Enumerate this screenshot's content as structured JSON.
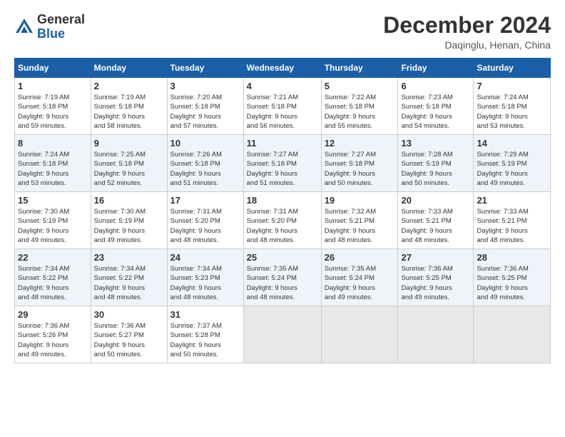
{
  "header": {
    "logo_line1": "General",
    "logo_line2": "Blue",
    "month_title": "December 2024",
    "location": "Daqinglu, Henan, China"
  },
  "weekdays": [
    "Sunday",
    "Monday",
    "Tuesday",
    "Wednesday",
    "Thursday",
    "Friday",
    "Saturday"
  ],
  "weeks": [
    [
      {
        "day": "1",
        "info": "Sunrise: 7:19 AM\nSunset: 5:18 PM\nDaylight: 9 hours\nand 59 minutes."
      },
      {
        "day": "2",
        "info": "Sunrise: 7:19 AM\nSunset: 5:18 PM\nDaylight: 9 hours\nand 58 minutes."
      },
      {
        "day": "3",
        "info": "Sunrise: 7:20 AM\nSunset: 5:18 PM\nDaylight: 9 hours\nand 57 minutes."
      },
      {
        "day": "4",
        "info": "Sunrise: 7:21 AM\nSunset: 5:18 PM\nDaylight: 9 hours\nand 56 minutes."
      },
      {
        "day": "5",
        "info": "Sunrise: 7:22 AM\nSunset: 5:18 PM\nDaylight: 9 hours\nand 55 minutes."
      },
      {
        "day": "6",
        "info": "Sunrise: 7:23 AM\nSunset: 5:18 PM\nDaylight: 9 hours\nand 54 minutes."
      },
      {
        "day": "7",
        "info": "Sunrise: 7:24 AM\nSunset: 5:18 PM\nDaylight: 9 hours\nand 53 minutes."
      }
    ],
    [
      {
        "day": "8",
        "info": "Sunrise: 7:24 AM\nSunset: 5:18 PM\nDaylight: 9 hours\nand 53 minutes."
      },
      {
        "day": "9",
        "info": "Sunrise: 7:25 AM\nSunset: 5:18 PM\nDaylight: 9 hours\nand 52 minutes."
      },
      {
        "day": "10",
        "info": "Sunrise: 7:26 AM\nSunset: 5:18 PM\nDaylight: 9 hours\nand 51 minutes."
      },
      {
        "day": "11",
        "info": "Sunrise: 7:27 AM\nSunset: 5:18 PM\nDaylight: 9 hours\nand 51 minutes."
      },
      {
        "day": "12",
        "info": "Sunrise: 7:27 AM\nSunset: 5:18 PM\nDaylight: 9 hours\nand 50 minutes."
      },
      {
        "day": "13",
        "info": "Sunrise: 7:28 AM\nSunset: 5:19 PM\nDaylight: 9 hours\nand 50 minutes."
      },
      {
        "day": "14",
        "info": "Sunrise: 7:29 AM\nSunset: 5:19 PM\nDaylight: 9 hours\nand 49 minutes."
      }
    ],
    [
      {
        "day": "15",
        "info": "Sunrise: 7:30 AM\nSunset: 5:19 PM\nDaylight: 9 hours\nand 49 minutes."
      },
      {
        "day": "16",
        "info": "Sunrise: 7:30 AM\nSunset: 5:19 PM\nDaylight: 9 hours\nand 49 minutes."
      },
      {
        "day": "17",
        "info": "Sunrise: 7:31 AM\nSunset: 5:20 PM\nDaylight: 9 hours\nand 48 minutes."
      },
      {
        "day": "18",
        "info": "Sunrise: 7:31 AM\nSunset: 5:20 PM\nDaylight: 9 hours\nand 48 minutes."
      },
      {
        "day": "19",
        "info": "Sunrise: 7:32 AM\nSunset: 5:21 PM\nDaylight: 9 hours\nand 48 minutes."
      },
      {
        "day": "20",
        "info": "Sunrise: 7:33 AM\nSunset: 5:21 PM\nDaylight: 9 hours\nand 48 minutes."
      },
      {
        "day": "21",
        "info": "Sunrise: 7:33 AM\nSunset: 5:21 PM\nDaylight: 9 hours\nand 48 minutes."
      }
    ],
    [
      {
        "day": "22",
        "info": "Sunrise: 7:34 AM\nSunset: 5:22 PM\nDaylight: 9 hours\nand 48 minutes."
      },
      {
        "day": "23",
        "info": "Sunrise: 7:34 AM\nSunset: 5:22 PM\nDaylight: 9 hours\nand 48 minutes."
      },
      {
        "day": "24",
        "info": "Sunrise: 7:34 AM\nSunset: 5:23 PM\nDaylight: 9 hours\nand 48 minutes."
      },
      {
        "day": "25",
        "info": "Sunrise: 7:35 AM\nSunset: 5:24 PM\nDaylight: 9 hours\nand 48 minutes."
      },
      {
        "day": "26",
        "info": "Sunrise: 7:35 AM\nSunset: 5:24 PM\nDaylight: 9 hours\nand 49 minutes."
      },
      {
        "day": "27",
        "info": "Sunrise: 7:36 AM\nSunset: 5:25 PM\nDaylight: 9 hours\nand 49 minutes."
      },
      {
        "day": "28",
        "info": "Sunrise: 7:36 AM\nSunset: 5:25 PM\nDaylight: 9 hours\nand 49 minutes."
      }
    ],
    [
      {
        "day": "29",
        "info": "Sunrise: 7:36 AM\nSunset: 5:26 PM\nDaylight: 9 hours\nand 49 minutes."
      },
      {
        "day": "30",
        "info": "Sunrise: 7:36 AM\nSunset: 5:27 PM\nDaylight: 9 hours\nand 50 minutes."
      },
      {
        "day": "31",
        "info": "Sunrise: 7:37 AM\nSunset: 5:28 PM\nDaylight: 9 hours\nand 50 minutes."
      },
      null,
      null,
      null,
      null
    ]
  ]
}
